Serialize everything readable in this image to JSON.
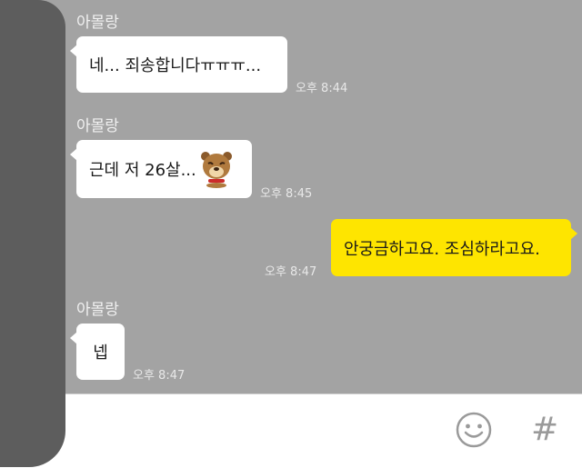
{
  "messages": [
    {
      "sender": "아몰랑",
      "text": "네... 죄송합니다ㅠㅠㅠ...",
      "time": "오후 8:44"
    },
    {
      "sender": "아몰랑",
      "text": "근데 저 26살...",
      "emoticon": "crying-bear-emoticon",
      "time": "오후 8:45"
    },
    {
      "sender": "",
      "text": "안궁금하고요. 조심하라고요.",
      "time": "오후 8:47",
      "mine": true
    },
    {
      "sender": "아몰랑",
      "text": "넵",
      "time": "오후 8:47"
    }
  ],
  "input_bar": {
    "emoji_icon": "smiley-icon",
    "hash_label": "#"
  },
  "colors": {
    "chat_background": "#a3a3a3",
    "my_bubble": "#fee500",
    "other_bubble": "#ffffff"
  }
}
